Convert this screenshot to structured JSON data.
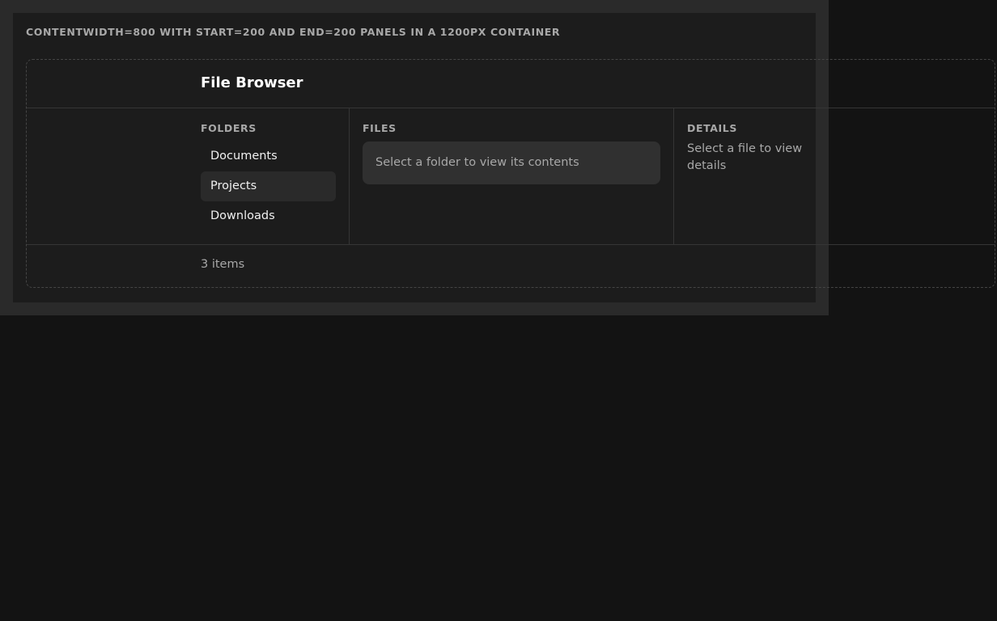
{
  "caption": "CONTENTWIDTH=800 WITH START=200 AND END=200 PANELS IN A 1200PX CONTAINER",
  "header": {
    "title": "File Browser"
  },
  "folders": {
    "label": "FOLDERS",
    "items": [
      "Documents",
      "Projects",
      "Downloads"
    ],
    "selected": "Projects"
  },
  "files": {
    "label": "FILES",
    "placeholder": "Select a folder to view its contents"
  },
  "details": {
    "label": "DETAILS",
    "placeholder": "Select a file to view details"
  },
  "footer": {
    "count_text": "3 items"
  },
  "colors": {
    "page_background": "#131313",
    "outer_frame": "#2a2a2a",
    "inner_panel": "#1c1c1c",
    "selected_item": "#2a2a2a",
    "placeholder_box": "#303030",
    "muted_text": "#a8a8a8",
    "primary_text": "#ffffff"
  }
}
